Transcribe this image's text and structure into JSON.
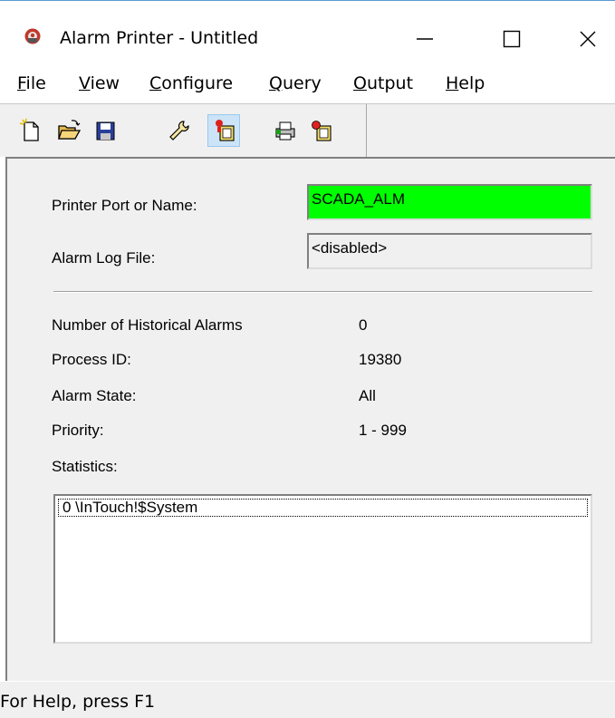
{
  "window": {
    "title": "Alarm Printer - Untitled"
  },
  "menu": {
    "items": [
      {
        "label": "File"
      },
      {
        "label": "View"
      },
      {
        "label": "Configure"
      },
      {
        "label": "Query"
      },
      {
        "label": "Output"
      },
      {
        "label": "Help"
      }
    ]
  },
  "toolbar": {
    "buttons": [
      "new-icon",
      "open-folder-icon",
      "save-icon",
      "wrench-icon",
      "alarm-start-icon",
      "printer-config-icon",
      "alarm-stop-icon"
    ],
    "pressed": "alarm-start-icon"
  },
  "form": {
    "printer_port_label": "Printer Port or Name:",
    "printer_port_value": "SCADA_ALM",
    "log_file_label": "Alarm Log File:",
    "log_file_value": "<disabled>",
    "historical_label": "Number of Historical Alarms",
    "historical_value": "0",
    "process_id_label": "Process ID:",
    "process_id_value": "19380",
    "alarm_state_label": "Alarm State:",
    "alarm_state_value": "All",
    "priority_label": "Priority:",
    "priority_value": "1 - 999",
    "statistics_label": "Statistics:"
  },
  "statistics": {
    "items": [
      "0 \\InTouch!$System"
    ]
  },
  "status": {
    "text": "For Help, press F1"
  },
  "colors": {
    "printer_field_bg": "#00ff00",
    "panel_bg": "#f0f0f0"
  }
}
